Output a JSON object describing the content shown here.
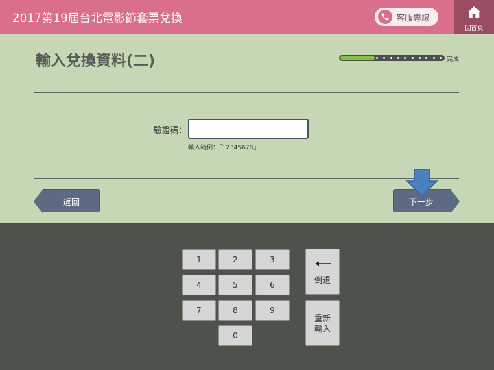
{
  "header": {
    "title": "2017第19屆台北電影節套票兌換",
    "service_label": "客服專線",
    "home_label": "回首頁"
  },
  "form": {
    "title": "輸入兌換資料(二)",
    "progress_label": "完成",
    "progress_fraction": 0.33,
    "field_label": "驗證碼：",
    "code_value": "",
    "code_placeholder": "",
    "hint": "輸入範例：「12345678」"
  },
  "nav": {
    "back_label": "返回",
    "next_label": "下一步"
  },
  "keypad": {
    "digits": [
      "1",
      "2",
      "3",
      "4",
      "5",
      "6",
      "7",
      "8",
      "9",
      "0"
    ],
    "backspace_label": "倒退",
    "reset_line1": "重新",
    "reset_line2": "輸入"
  },
  "colors": {
    "header": "#d96f8b",
    "home_button": "#9a4c60",
    "panel": "#c6d7b6",
    "keypad_area": "#4d534b",
    "nav_button": "#5d6b82",
    "progress_fill": "#82c341",
    "arrow": "#4a7fc0"
  },
  "icons": {
    "phone": "phone-icon",
    "home": "home-icon",
    "backspace": "left-arrow-icon",
    "pointer": "down-arrow-icon"
  }
}
